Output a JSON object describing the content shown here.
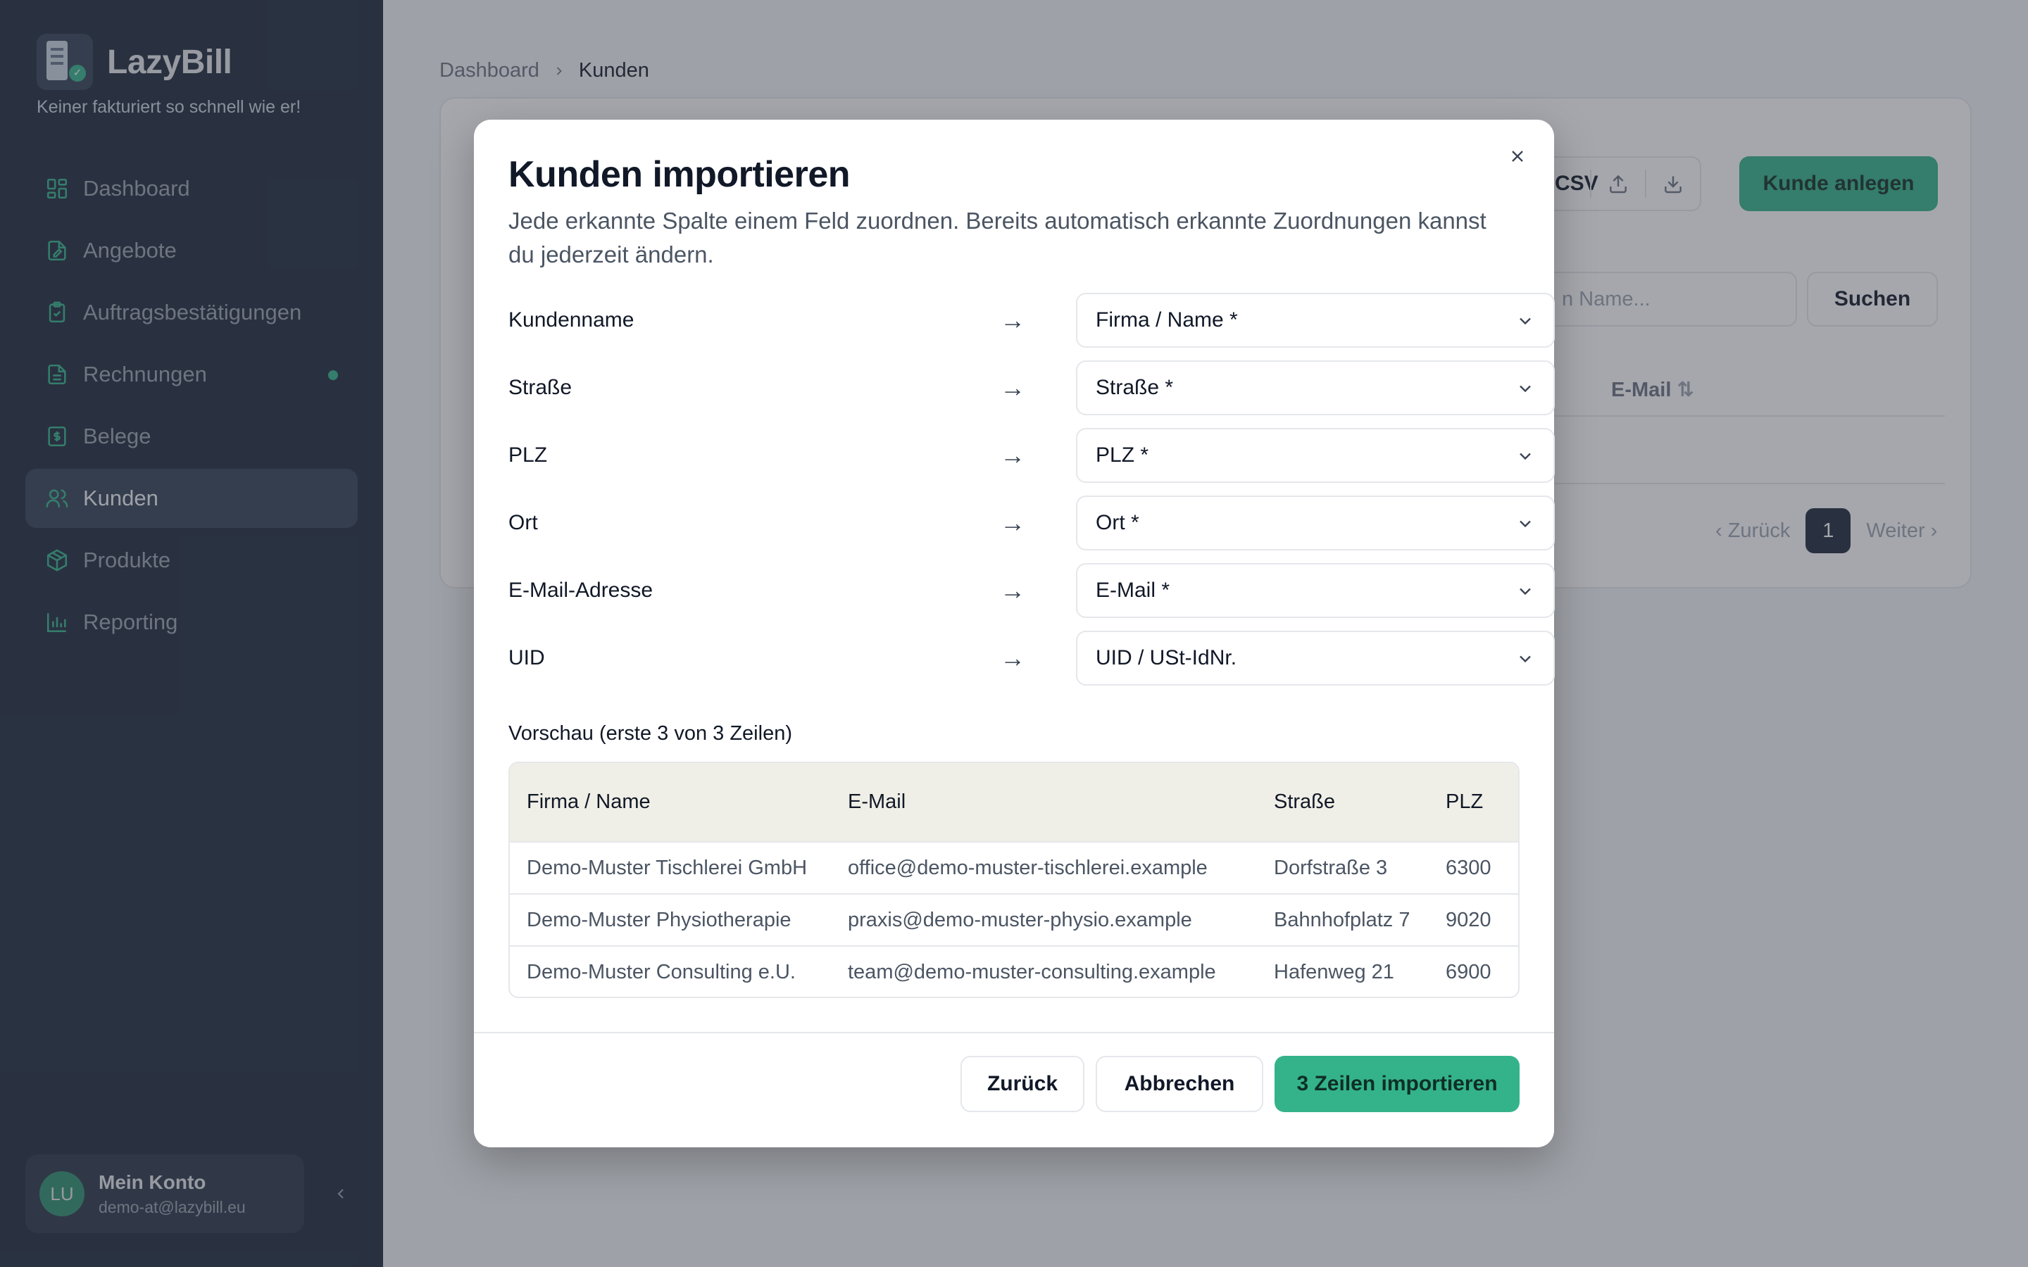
{
  "sidebar": {
    "brand": "LazyBill",
    "tagline": "Keiner fakturiert so schnell wie er!",
    "nav": [
      {
        "label": "Dashboard",
        "icon": "dashboard-icon"
      },
      {
        "label": "Angebote",
        "icon": "document-edit-icon"
      },
      {
        "label": "Auftragsbestätigungen",
        "icon": "clipboard-check-icon"
      },
      {
        "label": "Rechnungen",
        "icon": "invoice-icon"
      },
      {
        "label": "Belege",
        "icon": "receipt-icon"
      },
      {
        "label": "Kunden",
        "icon": "users-icon"
      },
      {
        "label": "Produkte",
        "icon": "package-icon"
      },
      {
        "label": "Reporting",
        "icon": "bar-chart-icon"
      }
    ],
    "account": {
      "initials": "LU",
      "name": "Mein Konto",
      "email": "demo-at@lazybill.eu"
    }
  },
  "breadcrumb": {
    "parent": "Dashboard",
    "current": "Kunden"
  },
  "background": {
    "csv_label": "CSV",
    "create_button": "Kunde anlegen",
    "search_placeholder": "n Name...",
    "search_button": "Suchen",
    "column_email": "E-Mail",
    "pager": {
      "prev": "Zurück",
      "page": "1",
      "next": "Weiter"
    }
  },
  "modal": {
    "title": "Kunden importieren",
    "description": "Jede erkannte Spalte einem Feld zuordnen. Bereits automatisch erkannte Zuordnungen kannst du jederzeit ändern.",
    "arrow": "→",
    "mappings": [
      {
        "source": "Kundenname",
        "target": "Firma / Name *"
      },
      {
        "source": "Straße",
        "target": "Straße *"
      },
      {
        "source": "PLZ",
        "target": "PLZ *"
      },
      {
        "source": "Ort",
        "target": "Ort *"
      },
      {
        "source": "E-Mail-Adresse",
        "target": "E-Mail *"
      },
      {
        "source": "UID",
        "target": "UID / USt-IdNr."
      }
    ],
    "preview_label": "Vorschau (erste 3 von 3 Zeilen)",
    "preview": {
      "headers": [
        "Firma / Name",
        "E-Mail",
        "Straße",
        "PLZ"
      ],
      "rows": [
        [
          "Demo-Muster Tischlerei GmbH",
          "office@demo-muster-tischlerei.example",
          "Dorfstraße 3",
          "6300"
        ],
        [
          "Demo-Muster Physiotherapie",
          "praxis@demo-muster-physio.example",
          "Bahnhofplatz 7",
          "9020"
        ],
        [
          "Demo-Muster Consulting e.U.",
          "team@demo-muster-consulting.example",
          "Hafenweg 21",
          "6900"
        ]
      ]
    },
    "buttons": {
      "back": "Zurück",
      "cancel": "Abbrechen",
      "import": "3 Zeilen importieren"
    }
  },
  "colors": {
    "sidebar": "#1e293b",
    "accent": "#34b38a",
    "active_nav": "#334155"
  }
}
